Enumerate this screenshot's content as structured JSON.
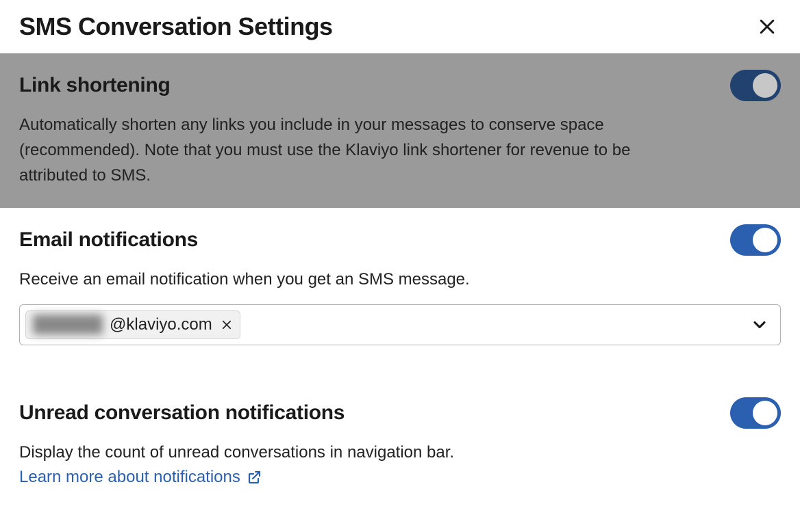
{
  "header": {
    "title": "SMS Conversation Settings"
  },
  "sections": {
    "link_shortening": {
      "title": "Link shortening",
      "description": "Automatically shorten any links you include in your messages to conserve space (recommended). Note that you must use the Klaviyo link shortener for revenue to be attributed to SMS.",
      "enabled": true
    },
    "email_notifications": {
      "title": "Email notifications",
      "description": "Receive an email notification when you get an SMS message.",
      "enabled": true,
      "email_chip": {
        "prefix_hidden": "██████",
        "domain": "@klaviyo.com"
      }
    },
    "unread_notifications": {
      "title": "Unread conversation notifications",
      "description": "Display the count of unread conversations in navigation bar.",
      "learn_more_label": "Learn more about notifications",
      "enabled": true
    }
  }
}
